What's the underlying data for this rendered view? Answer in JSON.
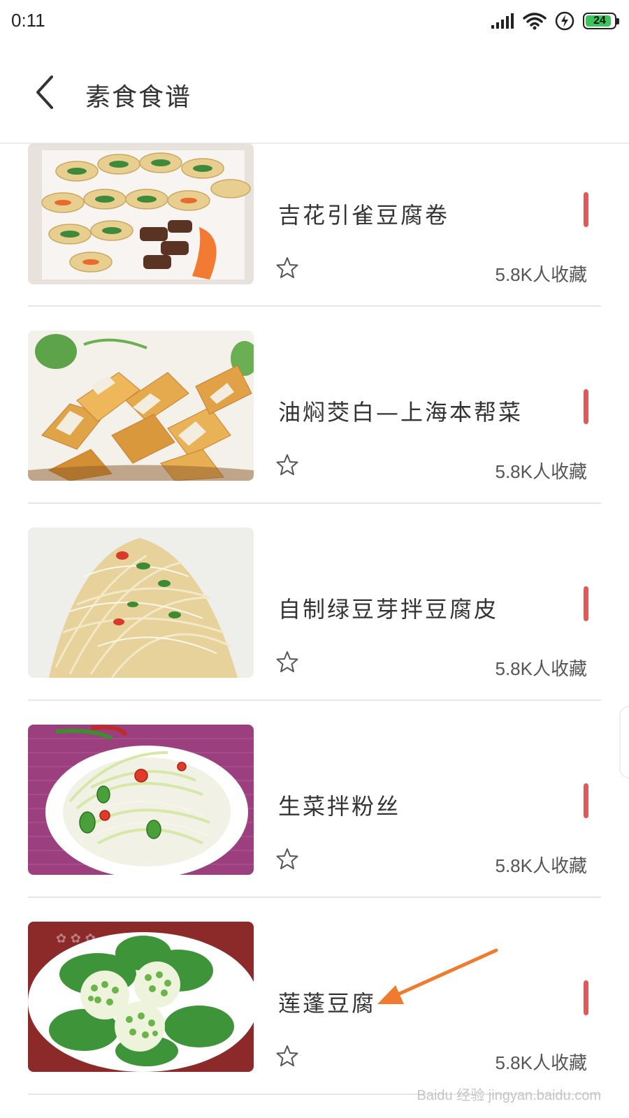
{
  "status_bar": {
    "time": "0:11",
    "battery": "24",
    "icons": [
      "signal-icon",
      "wifi-icon",
      "charging-icon",
      "battery-icon"
    ]
  },
  "header": {
    "title": "素食食谱",
    "back_icon": "chevron-left-icon"
  },
  "recipes": [
    {
      "title": "吉花引雀豆腐卷",
      "favorites": "5.8K人收藏"
    },
    {
      "title": "油焖茭白—上海本帮菜",
      "favorites": "5.8K人收藏"
    },
    {
      "title": "自制绿豆芽拌豆腐皮",
      "favorites": "5.8K人收藏"
    },
    {
      "title": "生菜拌粉丝",
      "favorites": "5.8K人收藏"
    },
    {
      "title": "莲蓬豆腐",
      "favorites": "5.8K人收藏"
    }
  ],
  "colors": {
    "accent_marker": "#e05a5a",
    "annotation_arrow": "#f07b2e",
    "battery_green": "#3cc35a"
  },
  "watermark": "Baidu 经验 jingyan.baidu.com"
}
